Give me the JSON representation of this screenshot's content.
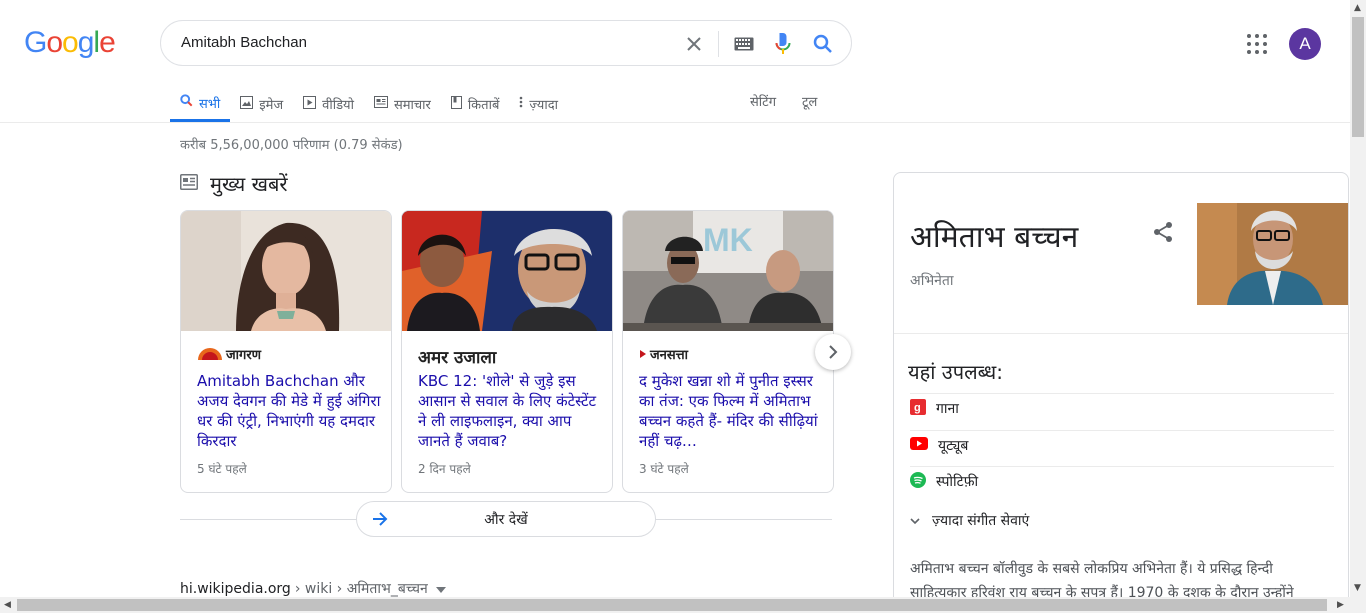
{
  "logo": [
    "G",
    "o",
    "o",
    "g",
    "l",
    "e"
  ],
  "logo_colors": [
    "#4285f4",
    "#ea4335",
    "#fbbc05",
    "#4285f4",
    "#34a853",
    "#ea4335"
  ],
  "search": {
    "query": "Amitabh Bachchan"
  },
  "account": {
    "avatar_letter": "A",
    "avatar_color": "#5b36a0"
  },
  "tabs": [
    {
      "label": "सभी",
      "icon": "search-icon",
      "active": true
    },
    {
      "label": "इमेज",
      "icon": "image-icon"
    },
    {
      "label": "वीडियो",
      "icon": "video-icon"
    },
    {
      "label": "समाचार",
      "icon": "news-icon"
    },
    {
      "label": "किताबें",
      "icon": "book-icon"
    },
    {
      "label": "ज़्यादा",
      "icon": "more-vert-icon"
    }
  ],
  "tools": {
    "settings": "सेटिंग",
    "tools": "टूल"
  },
  "results_count": "करीब 5,56,00,000 परिणाम (0.79 सेकंड)",
  "top_stories": {
    "title": "मुख्य खबरें",
    "cards": [
      {
        "source": "जागरण",
        "headline": "Amitabh Bachchan और अजय देवगन की मेडे में हुई अंगिरा धर की एंट्री, निभाएंगी यह दमदार किरदार",
        "time": "5 घंटे पहले"
      },
      {
        "source": "अमर उजाला",
        "headline": "KBC 12: 'शोले' से जुड़े इस आसान से सवाल के लिए कंटेस्टेंट ने ली लाइफलाइन, क्या आप जानते हैं जवाब?",
        "time": "2 दिन पहले"
      },
      {
        "source": "जनसत्ता",
        "headline": "द मुकेश खन्ना शो में पुनीत इस्सर का तंज: एक फिल्म में अमिताभ बच्चन कहते हैं- मंदिर की सीढ़ियां नहीं चढ़…",
        "time": "3 घंटे पहले"
      }
    ],
    "more_label": "और देखें"
  },
  "wiki": {
    "domain": "hi.wikipedia.org",
    "path": "› wiki › अमिताभ_बच्चन"
  },
  "knowledge_panel": {
    "name": "अमिताभ बच्चन",
    "subtitle": "अभिनेता",
    "available_title": "यहां उपलब्ध:",
    "services": [
      {
        "label": "गाना",
        "icon": "gaana-icon",
        "color": "#e72c30"
      },
      {
        "label": "यूट्यूब",
        "icon": "youtube-icon",
        "color": "#ff0000"
      },
      {
        "label": "स्पोटिफ़ी",
        "icon": "spotify-icon",
        "color": "#1db954"
      }
    ],
    "more_services": "ज़्यादा संगीत सेवाएं",
    "description": "अमिताभ बच्चन बॉलीवुड के सबसे लोकप्रिय अभिनेता हैं। ये प्रसिद्ध हिन्दी साहित्यकार हरिवंश राय बच्चन के सपुत्र हैं। 1970 के दशक के दौरान उन्होंने"
  }
}
